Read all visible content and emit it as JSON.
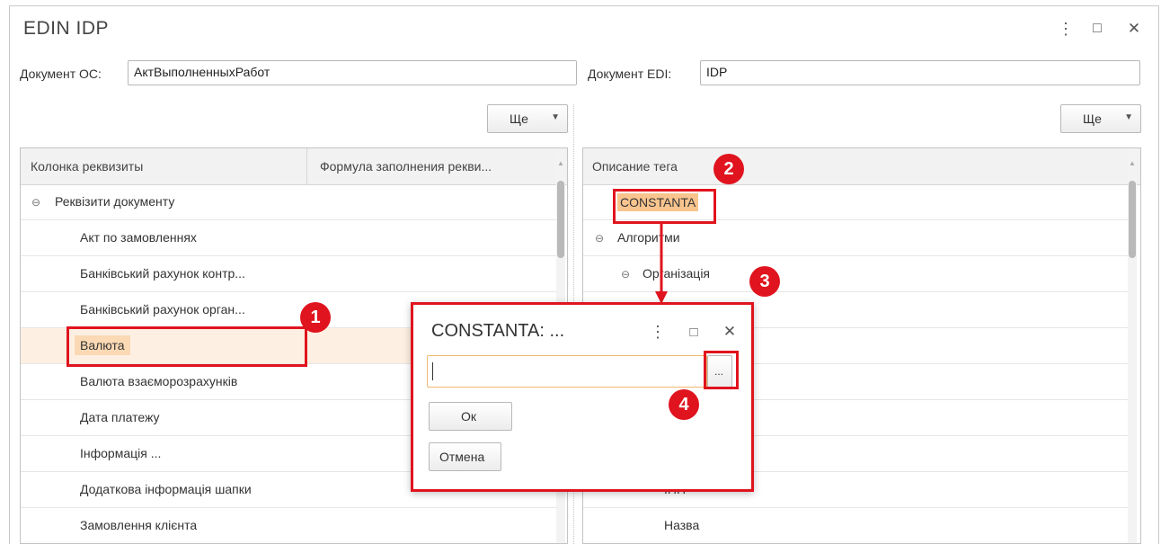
{
  "window": {
    "title": "EDIN IDP",
    "menu_icon": "⋮",
    "maximize_icon": "□",
    "close_icon": "✕"
  },
  "left": {
    "doc_label": "Документ ОС:",
    "doc_value": "АктВыполненныхРабот",
    "more_button": "Ще",
    "table": {
      "col1": "Колонка реквизиты",
      "col2": "Формула заполнения рекви...",
      "rows": [
        {
          "label": "Реквізити документу",
          "group": true
        },
        {
          "label": "Акт по замовленнях"
        },
        {
          "label": "Банківський рахунок контр..."
        },
        {
          "label": "Банківський рахунок орган..."
        },
        {
          "label": "Валюта",
          "selected": true
        },
        {
          "label": "Валюта взаєморозрахунків"
        },
        {
          "label": "Дата платежу"
        },
        {
          "label": "Інформація ..."
        },
        {
          "label": "Додаткова інформація шапки"
        },
        {
          "label": "Замовлення клієнта"
        }
      ]
    }
  },
  "right": {
    "doc_label": "Документ EDI:",
    "doc_value": "IDP",
    "more_button": "Ще",
    "table": {
      "col1": "Описание тега",
      "rows": [
        {
          "label": "CONSTANTA"
        },
        {
          "label": "Алгоритми",
          "group": true
        },
        {
          "label": "Організація",
          "group": true
        },
        {
          "label": "ІПН"
        },
        {
          "label": "Назва"
        }
      ]
    }
  },
  "dialog": {
    "title": "CONSTANTA: ...",
    "menu_icon": "⋮",
    "maximize_icon": "□",
    "close_icon": "✕",
    "input_value": "",
    "select_button": "...",
    "ok_button": "Ок",
    "cancel_button": "Отмена"
  },
  "annotations": {
    "b1": "1",
    "b2": "2",
    "b3": "3",
    "b4": "4"
  },
  "colors": {
    "accent_red": "#e0141e",
    "selection": "#fbe0c2",
    "highlight": "#f9c48e"
  }
}
